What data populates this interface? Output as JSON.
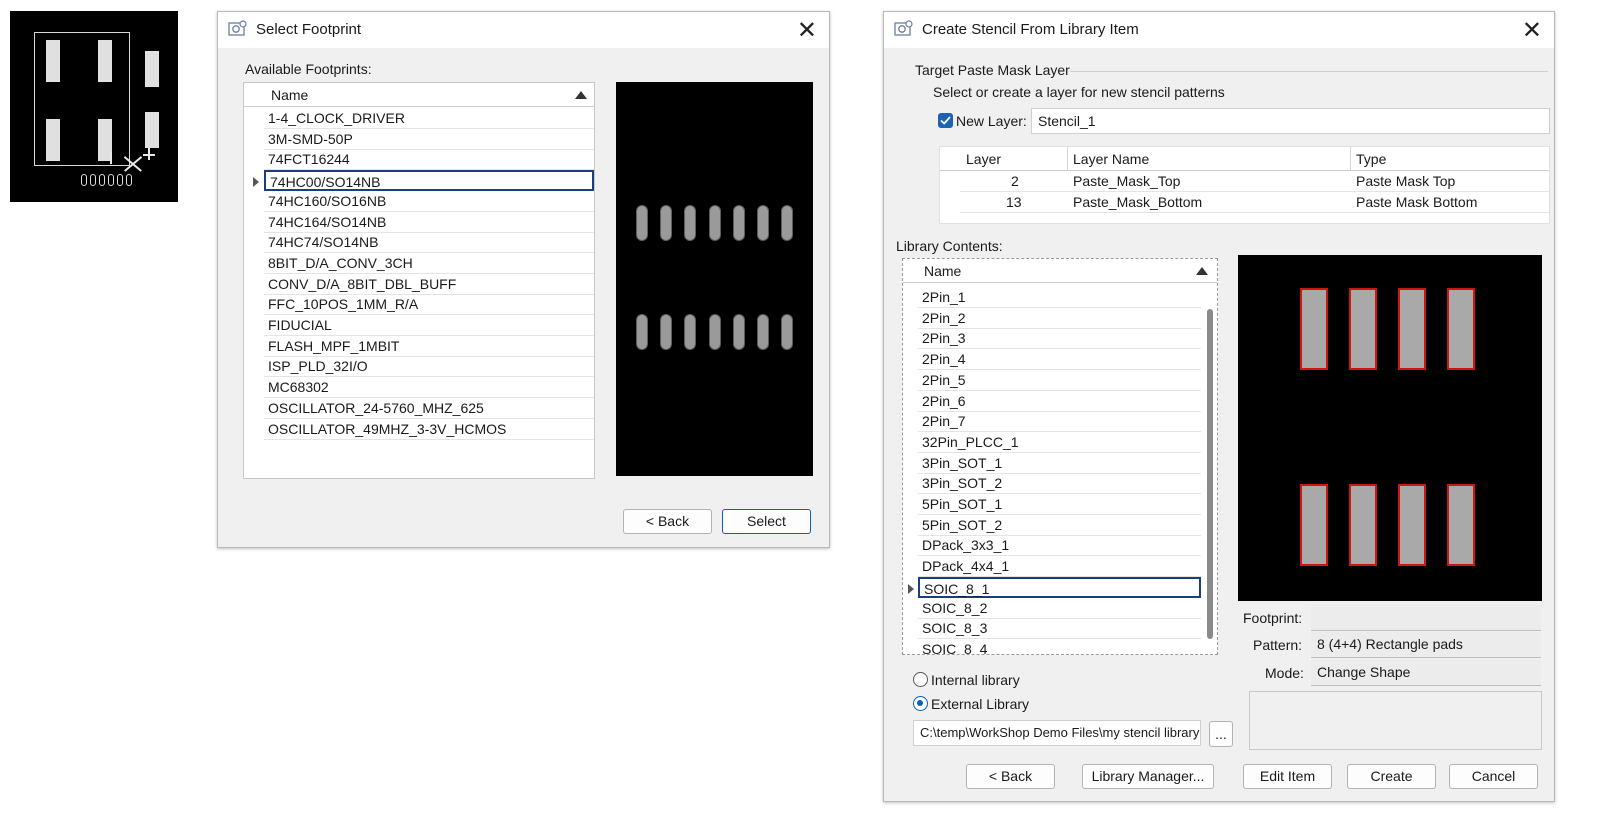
{
  "select_footprint": {
    "title": "Select Footprint",
    "available_label": "Available Footprints:",
    "column_name": "Name",
    "items": [
      "1-4_CLOCK_DRIVER",
      "3M-SMD-50P",
      "74FCT16244",
      "74HC00/SO14NB",
      "74HC160/SO16NB",
      "74HC164/SO14NB",
      "74HC74/SO14NB",
      "8BIT_D/A_CONV_3CH",
      "CONV_D/A_8BIT_DBL_BUFF",
      "FFC_10POS_1MM_R/A",
      "FIDUCIAL",
      "FLASH_MPF_1MBIT",
      "ISP_PLD_32I/O",
      "MC68302",
      "OSCILLATOR_24-5760_MHZ_625",
      "OSCILLATOR_49MHZ_3-3V_HCMOS"
    ],
    "selected_item": "74HC00/SO14NB",
    "back_label": "< Back",
    "select_label": "Select"
  },
  "create_stencil": {
    "title": "Create Stencil From Library Item",
    "target_group_label": "Target Paste Mask Layer",
    "target_hint": "Select or create a layer for new stencil patterns",
    "new_layer_label": "New Layer:",
    "new_layer_value": "Stencil_1",
    "new_layer_checked": true,
    "layers_table": {
      "headers": [
        "Layer",
        "Layer Name",
        "Type"
      ],
      "rows": [
        {
          "layer": "2",
          "name": "Paste_Mask_Top",
          "type": "Paste Mask Top"
        },
        {
          "layer": "13",
          "name": "Paste_Mask_Bottom",
          "type": "Paste Mask Bottom"
        }
      ]
    },
    "library_contents_label": "Library Contents:",
    "column_name": "Name",
    "library_items": [
      "2Pin_1",
      "2Pin_2",
      "2Pin_3",
      "2Pin_4",
      "2Pin_5",
      "2Pin_6",
      "2Pin_7",
      "32Pin_PLCC_1",
      "3Pin_SOT_1",
      "3Pin_SOT_2",
      "5Pin_SOT_1",
      "5Pin_SOT_2",
      "DPack_3x3_1",
      "DPack_4x4_1",
      "SOIC_8_1",
      "SOIC_8_2",
      "SOIC_8_3",
      "SOIC_8_4"
    ],
    "selected_item": "SOIC_8_1",
    "footprint_label": "Footprint:",
    "footprint_value": "",
    "pattern_label": "Pattern:",
    "pattern_value": "8 (4+4) Rectangle pads",
    "mode_label": "Mode:",
    "mode_value": "Change Shape",
    "internal_library_label": "Internal library",
    "external_library_label": "External Library",
    "library_source": "external",
    "library_path": "C:\\temp\\WorkShop Demo Files\\my stencil library",
    "browse_label": "...",
    "buttons": {
      "back": "< Back",
      "library_manager": "Library Manager...",
      "edit_item": "Edit Item",
      "create": "Create",
      "cancel": "Cancel"
    },
    "pad_outline_color": "#d01414"
  }
}
